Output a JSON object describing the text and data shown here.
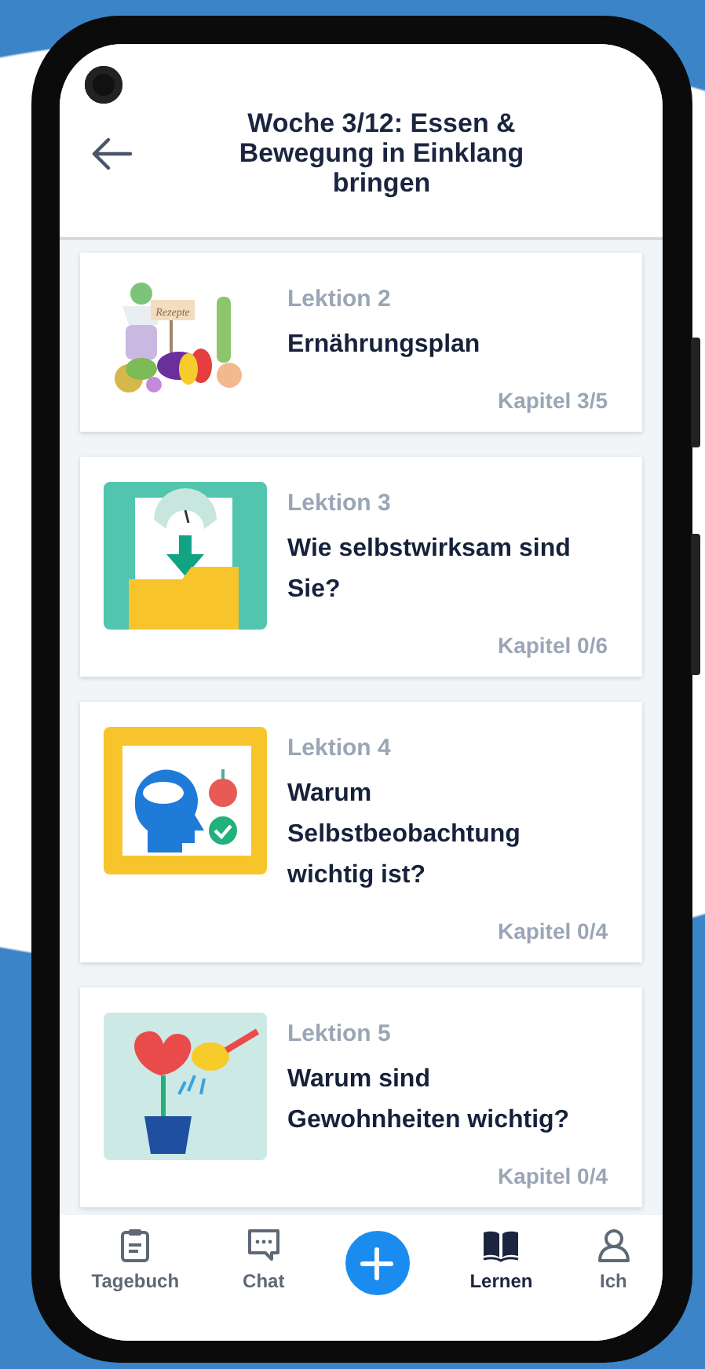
{
  "header": {
    "title": "Woche 3/12: Essen & Bewegung in Einklang bringen"
  },
  "lessons": [
    {
      "kind": "food",
      "label": "Lektion 2",
      "title": "Ernährungsplan",
      "image_text": "Rezepte",
      "progress": "Kapitel 3/5"
    },
    {
      "kind": "scale",
      "label": "Lektion 3",
      "title": "Wie selbstwirksam sind Sie?",
      "progress": "Kapitel 0/6"
    },
    {
      "kind": "mind",
      "label": "Lektion 4",
      "title": "Warum Selbstbeobachtung wichtig ist?",
      "progress": "Kapitel 0/4"
    },
    {
      "kind": "habit",
      "label": "Lektion 5",
      "title": "Warum sind Gewohnheiten wichtig?",
      "progress": "Kapitel 0/4"
    }
  ],
  "nav": [
    {
      "kind": "diary",
      "label": "Tagebuch",
      "selected": false
    },
    {
      "kind": "chat",
      "label": "Chat",
      "selected": false
    },
    {
      "kind": "add"
    },
    {
      "kind": "learn",
      "label": "Lernen",
      "selected": true
    },
    {
      "kind": "profile",
      "label": "Ich",
      "selected": false
    }
  ]
}
